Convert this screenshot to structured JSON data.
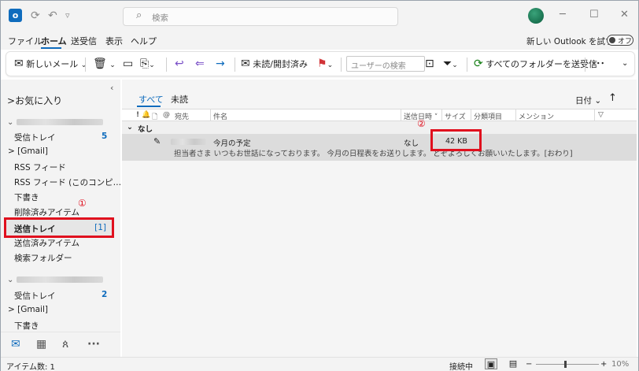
{
  "titlebar": {
    "search_placeholder": "検索",
    "icons": [
      "outlook-icon",
      "sync-icon",
      "undo-icon",
      "quick-access-dropdown-icon"
    ]
  },
  "menu": {
    "items": [
      "ファイル",
      "ホーム",
      "送受信",
      "表示",
      "ヘルプ"
    ],
    "active": "ホーム",
    "new_outlook_label": "新しい Outlook を試す",
    "toggle_label": "オフ"
  },
  "ribbon": {
    "new_mail": "新しいメール",
    "read_unread": "未読/開封済み",
    "user_search_placeholder": "ユーザーの検索",
    "send_receive_all": "すべてのフォルダーを送受信",
    "more": "･･･"
  },
  "folders": {
    "favorites": "お気に入り",
    "account1": {
      "items": [
        {
          "label": "受信トレイ",
          "count": "5"
        },
        {
          "label": "[Gmail]",
          "expandable": true
        },
        {
          "label": "RSS フィード"
        },
        {
          "label": "RSS フィード (このコンピ…"
        },
        {
          "label": "下書き"
        },
        {
          "label": "削除済みアイテム"
        },
        {
          "label": "送信トレイ",
          "count": "[1]",
          "selected": true
        },
        {
          "label": "送信済みアイテム"
        },
        {
          "label": "検索フォルダー"
        }
      ]
    },
    "account2": {
      "items": [
        {
          "label": "受信トレイ",
          "count": "2"
        },
        {
          "label": "[Gmail]",
          "expandable": true
        },
        {
          "label": "下書き"
        }
      ]
    }
  },
  "annotations": {
    "marker1": "①",
    "marker2": "②"
  },
  "list": {
    "tabs": [
      "すべて",
      "未読"
    ],
    "sort_label": "日付",
    "columns": [
      "!",
      "宛先",
      "件名",
      "送信日時",
      "サイズ",
      "分類項目",
      "メンション"
    ],
    "group": "なし",
    "message": {
      "subject": "今月の予定",
      "date": "なし",
      "size": "42 KB",
      "preview": "担当者さま  いつもお世話になっております。 今月の日程表をお送りします。 どぞよろしくお願いいたします。[おわり]"
    }
  },
  "status": {
    "item_count": "アイテム数: 1",
    "connection": "接続中",
    "zoom": "10%"
  },
  "colors": {
    "accent": "#0f6cbd",
    "highlight": "#e0101e"
  }
}
